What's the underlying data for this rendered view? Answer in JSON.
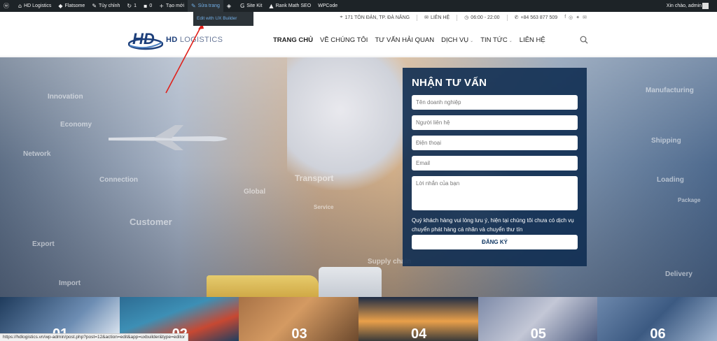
{
  "adminbar": {
    "site_name": "HD Logistics",
    "theme": "Flatsome",
    "customize": "Tùy chỉnh",
    "updates_count": "1",
    "comments_count": "0",
    "new": "Tạo mới",
    "edit_page": "Sửa trang",
    "site_kit": "Site Kit",
    "rank_math": "Rank Math SEO",
    "wpcode": "WPCode",
    "greeting": "Xin chào, admin",
    "dropdown_item": "Edit with UX Builder"
  },
  "topbar": {
    "address": "171 TÔN ĐẢN, TP. ĐÀ NẴNG",
    "contact": "LIÊN HỆ",
    "hours": "06:00 - 22:00",
    "phone": "+84 563 877 509"
  },
  "logo": {
    "brand_bold": "HD",
    "brand_light": "LOGISTICS"
  },
  "menu": [
    {
      "label": "TRANG CHỦ"
    },
    {
      "label": "VỀ CHÚNG TÔI"
    },
    {
      "label": "TƯ VẤN HẢI QUAN"
    },
    {
      "label": "DỊCH VỤ"
    },
    {
      "label": "TIN TỨC"
    },
    {
      "label": "LIÊN HỆ"
    }
  ],
  "hero_words": [
    "Innovation",
    "Economy",
    "Network",
    "Connection",
    "Customer",
    "Export",
    "Import",
    "Global",
    "Transport",
    "Service",
    "Supply chain",
    "Manufacturing",
    "Shipping",
    "Loading",
    "Package",
    "Delivery"
  ],
  "form": {
    "title": "NHẬN TƯ VẤN",
    "company_placeholder": "Tên doanh nghiệp",
    "contact_placeholder": "Người liên hệ",
    "phone_placeholder": "Điện thoại",
    "email_placeholder": "Email",
    "message_placeholder": "Lời nhắn của bạn",
    "note": "Quý khách hàng vui lòng lưu ý, hiện tại chúng tôi chưa có dịch vụ chuyển phát hàng cá nhân và chuyển thư tín",
    "submit": "ĐĂNG KÝ"
  },
  "cards": [
    "01",
    "02",
    "03",
    "04",
    "05",
    "06"
  ],
  "statusbar": "https://hdlogistics.vn/wp-admin/post.php?post=12&action=edit&app=uxbuilder&type=editor",
  "colors": {
    "form_bg": "#102e52",
    "brand_blue": "#1d3f7a",
    "admin_bar": "#1d2327",
    "annot_red": "#e0201a"
  }
}
